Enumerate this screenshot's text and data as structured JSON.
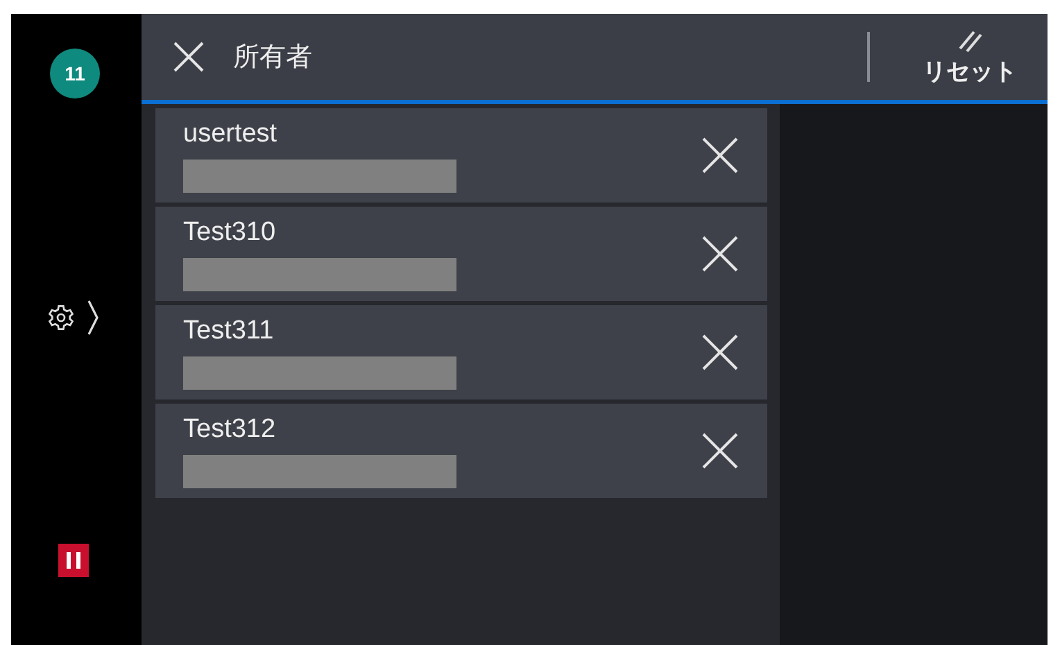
{
  "sidebar": {
    "badge": "11"
  },
  "header": {
    "title": "所有者",
    "reset_label": "リセット"
  },
  "owners": [
    {
      "name": "usertest"
    },
    {
      "name": "Test310"
    },
    {
      "name": "Test311"
    },
    {
      "name": "Test312"
    }
  ]
}
